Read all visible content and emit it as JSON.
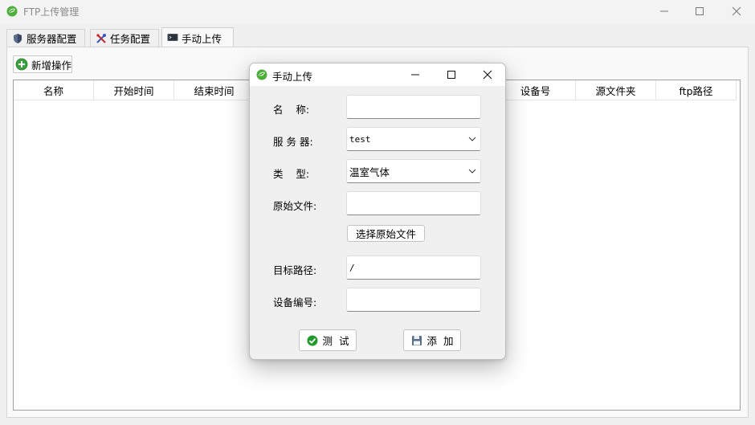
{
  "window": {
    "title": "FTP上传管理",
    "icon": "leaf-globe-icon"
  },
  "tabs": [
    {
      "label": "服务器配置",
      "icon": "shield-icon"
    },
    {
      "label": "任务配置",
      "icon": "tools-icon"
    },
    {
      "label": "手动上传",
      "icon": "terminal-icon",
      "active": true
    }
  ],
  "toolbar": {
    "add_label": "新增操作",
    "add_icon": "plus-circle-icon"
  },
  "table": {
    "columns": [
      "名称",
      "开始时间",
      "结束时间",
      "",
      "",
      "",
      "设备号",
      "源文件夹",
      "ftp路径"
    ],
    "rows": []
  },
  "dialog": {
    "title": "手动上传",
    "icon": "leaf-globe-icon",
    "fields": {
      "name_label": "名    称:",
      "name_value": "",
      "server_label": "服 务 器:",
      "server_value": "test",
      "type_label": "类    型:",
      "type_value": "温室气体",
      "source_label": "原始文件:",
      "source_value": "",
      "choose_button": "选择原始文件",
      "target_label": "目标路径:",
      "target_value": "/",
      "device_label": "设备编号:",
      "device_value": ""
    },
    "buttons": {
      "test_label": "测  试",
      "test_icon": "check-circle-icon",
      "add_label": "添  加",
      "add_icon": "floppy-disk-icon"
    }
  },
  "colors": {
    "accent_green": "#2e9e3a",
    "window_bg": "#f0f0f0"
  }
}
